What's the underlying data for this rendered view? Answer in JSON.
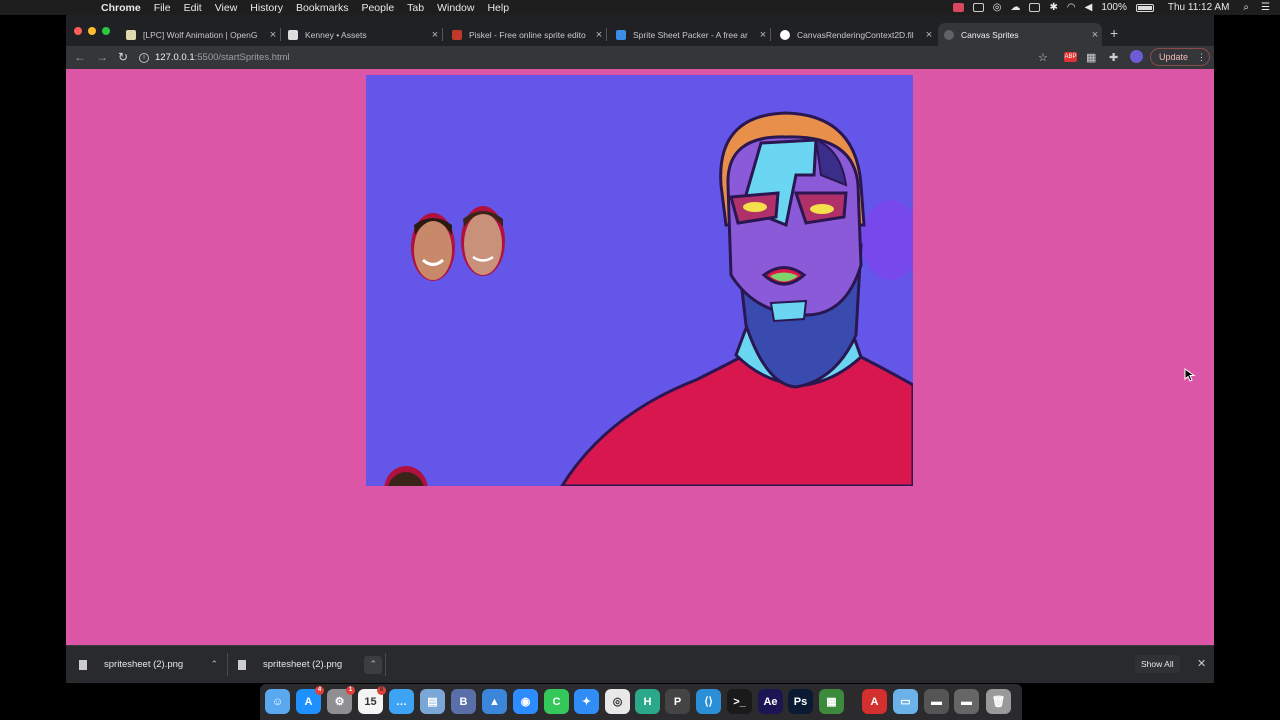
{
  "menubar": {
    "items": [
      "Chrome",
      "File",
      "Edit",
      "View",
      "History",
      "Bookmarks",
      "People",
      "Tab",
      "Window",
      "Help"
    ],
    "battery": "100%",
    "clock": "Thu 11:12 AM"
  },
  "tabs": [
    {
      "label": "[LPC] Wolf Animation | OpenG",
      "favicon": "opengameart-icon",
      "color": "#e0d9b0"
    },
    {
      "label": "Kenney • Assets",
      "favicon": "kenney-icon",
      "color": "#dddddd"
    },
    {
      "label": "Piskel - Free online sprite edito",
      "favicon": "piskel-icon",
      "color": "#c0392b"
    },
    {
      "label": "Sprite Sheet Packer - A free ar",
      "favicon": "spritepacker-icon",
      "color": "#3a8ee6"
    },
    {
      "label": "CanvasRenderingContext2D.fil",
      "favicon": "mdn-icon",
      "color": "#ffffff"
    },
    {
      "label": "Canvas Sprites",
      "favicon": "globe-icon",
      "color": "#777777",
      "active": true
    }
  ],
  "toolbar": {
    "url_host": "127.0.0.1",
    "url_rest": ":5500/startSprites.html",
    "update_label": "Update"
  },
  "page": {
    "background": "#db56a6",
    "canvas_background": "#6556ea"
  },
  "downloads": [
    {
      "name": "spritesheet (2).png"
    },
    {
      "name": "spritesheet (2).png"
    }
  ],
  "shelf": {
    "show_all": "Show All"
  },
  "dock": {
    "apps": [
      {
        "name": "finder-icon",
        "color": "#5aa9f0",
        "glyph": "☺"
      },
      {
        "name": "app-store-icon",
        "color": "#1e90ff",
        "glyph": "A",
        "badge": "4"
      },
      {
        "name": "system-preferences-icon",
        "color": "#8e8e93",
        "glyph": "⚙",
        "badge": "1"
      },
      {
        "name": "calendar-icon",
        "color": "#f4f4f4",
        "glyph": "15",
        "badge": "8"
      },
      {
        "name": "messages-icon",
        "color": "#3ea3f5",
        "glyph": "…"
      },
      {
        "name": "preview-icon",
        "color": "#7aa7d6",
        "glyph": "▤"
      },
      {
        "name": "bbedit-icon",
        "color": "#5a6fa8",
        "glyph": "B"
      },
      {
        "name": "keynote-icon",
        "color": "#3b86d8",
        "glyph": "▲"
      },
      {
        "name": "zoom-icon",
        "color": "#2d8cff",
        "glyph": "◉"
      },
      {
        "name": "facetime-icon",
        "color": "#34c759",
        "glyph": "C"
      },
      {
        "name": "safari-icon",
        "color": "#2f8df5",
        "glyph": "✦"
      },
      {
        "name": "chrome-icon",
        "color": "#e8e8e8",
        "glyph": "◎"
      },
      {
        "name": "hype-icon",
        "color": "#2aa889",
        "glyph": "H"
      },
      {
        "name": "pixelmator-icon",
        "color": "#444",
        "glyph": "P"
      },
      {
        "name": "vscode-icon",
        "color": "#2b8fd8",
        "glyph": "⟨⟩"
      },
      {
        "name": "terminal-icon",
        "color": "#1a1a1a",
        "glyph": ">_"
      },
      {
        "name": "after-effects-icon",
        "color": "#1b1553",
        "glyph": "Ae"
      },
      {
        "name": "photoshop-icon",
        "color": "#0a1a33",
        "glyph": "Ps"
      },
      {
        "name": "numbers-grid-icon",
        "color": "#3c8b3c",
        "glyph": "▦"
      },
      {
        "name": "acrobat-icon",
        "color": "#d32f2f",
        "glyph": "A"
      },
      {
        "name": "folder-icon",
        "color": "#6ab2e8",
        "glyph": "▭"
      },
      {
        "name": "downloads-stack-icon",
        "color": "#555",
        "glyph": "▬"
      },
      {
        "name": "screens-stack-icon",
        "color": "#666",
        "glyph": "▬"
      },
      {
        "name": "trash-icon",
        "color": "#9a9a9a",
        "glyph": "🗑"
      }
    ]
  }
}
